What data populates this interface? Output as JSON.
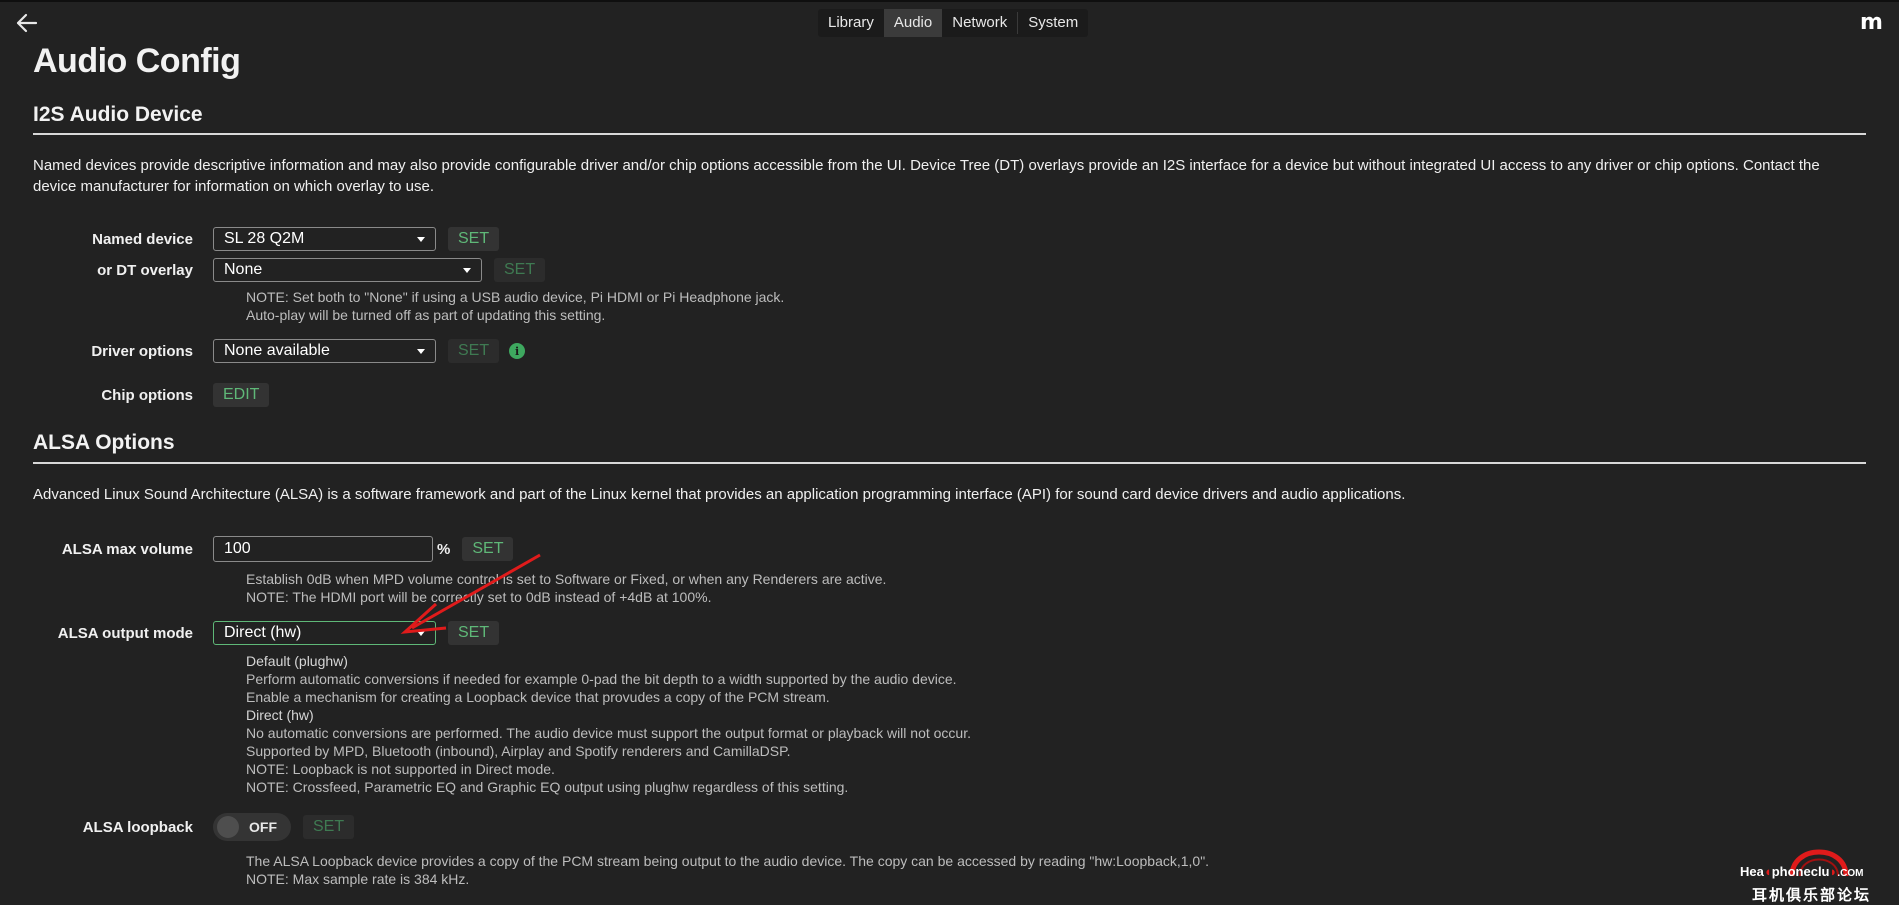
{
  "header": {
    "back_icon": "arrow-left-icon",
    "tabs": [
      {
        "label": "Library",
        "active": false
      },
      {
        "label": "Audio",
        "active": true
      },
      {
        "label": "Network",
        "active": false
      },
      {
        "label": "System",
        "active": false
      }
    ],
    "logo": "m"
  },
  "page": {
    "title": "Audio Config"
  },
  "i2s": {
    "heading": "I2S Audio Device",
    "description": "Named devices provide descriptive information and may also provide configurable driver and/or chip options accessible from the UI. Device Tree (DT) overlays provide an I2S interface for a device but without integrated UI access to any driver or chip options. Contact the device manufacturer for information on which overlay to use.",
    "named_device": {
      "label": "Named device",
      "value": "SL 28 Q2M",
      "button": "SET"
    },
    "dt_overlay": {
      "label": "or DT overlay",
      "value": "None",
      "button": "SET"
    },
    "overlay_note": [
      "NOTE: Set both to \"None\" if using a USB audio device, Pi HDMI or Pi Headphone jack.",
      "Auto-play will be turned off as part of updating this setting."
    ],
    "driver_options": {
      "label": "Driver options",
      "value": "None available",
      "button": "SET",
      "info_icon": "info-icon"
    },
    "chip_options": {
      "label": "Chip options",
      "button": "EDIT"
    }
  },
  "alsa": {
    "heading": "ALSA Options",
    "description": "Advanced Linux Sound Architecture (ALSA) is a software framework and part of the Linux kernel that provides an application programming interface (API) for sound card device drivers and audio applications.",
    "max_volume": {
      "label": "ALSA max volume",
      "value": "100",
      "unit": "%",
      "button": "SET",
      "notes": [
        "Establish 0dB when MPD volume control is set to Software or Fixed, or when any Renderers are active.",
        "NOTE: The HDMI port will be correctly set to 0dB instead of +4dB at 100%."
      ]
    },
    "output_mode": {
      "label": "ALSA output mode",
      "value": "Direct (hw)",
      "button": "SET",
      "notes": [
        "Default (plughw)",
        "Perform automatic conversions if needed for example 0-pad the bit depth to a width supported by the audio device.",
        "Enable a mechanism for creating a Loopback device that provudes a copy of the PCM stream.",
        "Direct (hw)",
        "No automatic conversions are performed. The audio device must support the output format or playback will not occur.",
        "Supported by MPD, Bluetooth (inbound), Airplay and Spotify renderers and CamillaDSP.",
        "NOTE: Loopback is not supported in Direct mode.",
        "NOTE: Crossfeed, Parametric EQ and Graphic EQ output using plughw regardless of this setting."
      ]
    },
    "loopback": {
      "label": "ALSA loopback",
      "toggle": "OFF",
      "button": "SET",
      "notes": [
        "The ALSA Loopback device provides a copy of the PCM stream being output to the audio device. The copy can be accessed by reading \"hw:Loopback,1,0\".",
        "NOTE: Max sample rate is 384 kHz."
      ]
    }
  },
  "annotation": {
    "type": "red-arrow",
    "color": "#e01b1b"
  },
  "watermark": {
    "text_en_pre": "Hea",
    "text_en_mid": "phoneclu",
    "text_en_post": ".COM",
    "text_cn": "耳机俱乐部论坛",
    "color": "#e01b1b"
  },
  "colors": {
    "background": "#222222",
    "accent_green": "#5fb878",
    "text": "#f0f0f0",
    "muted_text": "#bdbdbd"
  }
}
